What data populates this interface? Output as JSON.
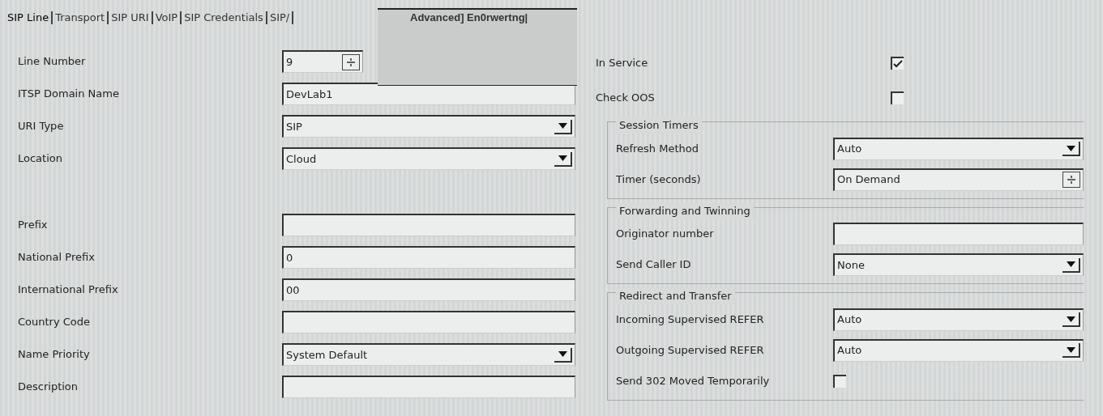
{
  "tabs": [
    {
      "label": "SIP Line",
      "selected": true
    },
    {
      "label": "Transport",
      "selected": false
    },
    {
      "label": "SIP URI",
      "selected": false
    },
    {
      "label": "VoIP",
      "selected": false
    },
    {
      "label": "SIP Credentials",
      "selected": false
    },
    {
      "label": "SIP/",
      "selected": false
    }
  ],
  "tab_overlay": {
    "text": "Advanced] En0rwertng|"
  },
  "line_fields": [
    {
      "label": "Line Number",
      "kind": "spin",
      "value": "9"
    },
    {
      "label": "ITSP Domain Name",
      "kind": "text",
      "value": "DevLab1"
    },
    {
      "label": "URI Type",
      "kind": "select",
      "value": "SIP"
    },
    {
      "label": "Location",
      "kind": "select",
      "value": "Cloud"
    }
  ],
  "dialing_fields": [
    {
      "label": "Prefix",
      "kind": "text"
    },
    {
      "label": "National Prefix",
      "kind": "text",
      "value": "0"
    },
    {
      "label": "International Prefix",
      "kind": "text",
      "value": "00"
    },
    {
      "label": "Country Code",
      "kind": "text"
    },
    {
      "label": "Name Priority",
      "kind": "select",
      "value": "System Default"
    },
    {
      "label": "Description",
      "kind": "text"
    }
  ],
  "options": [
    {
      "label": "In Service",
      "kind": "checkbox",
      "checked": true
    },
    {
      "label": "Check OOS",
      "kind": "checkbox",
      "checked": false
    }
  ],
  "groups": [
    {
      "title": "Session Timers",
      "fields": [
        {
          "label": "Refresh Method",
          "kind": "select",
          "value": "Auto"
        },
        {
          "label": "Timer (seconds)",
          "kind": "spin",
          "value": "On Demand"
        }
      ]
    },
    {
      "title": "Forwarding and Twinning",
      "fields": [
        {
          "label": "Originator number",
          "kind": "text"
        },
        {
          "label": "Send Caller ID",
          "kind": "select",
          "value": "None"
        }
      ]
    },
    {
      "title": "Redirect and Transfer",
      "fields": [
        {
          "label": "Incoming Supervised REFER",
          "kind": "select",
          "value": "Auto"
        },
        {
          "label": "Outgoing Supervised REFER",
          "kind": "select",
          "value": "Auto"
        },
        {
          "label": "Send 302 Moved Temporarily",
          "kind": "checkbox",
          "checked": false
        }
      ]
    }
  ]
}
